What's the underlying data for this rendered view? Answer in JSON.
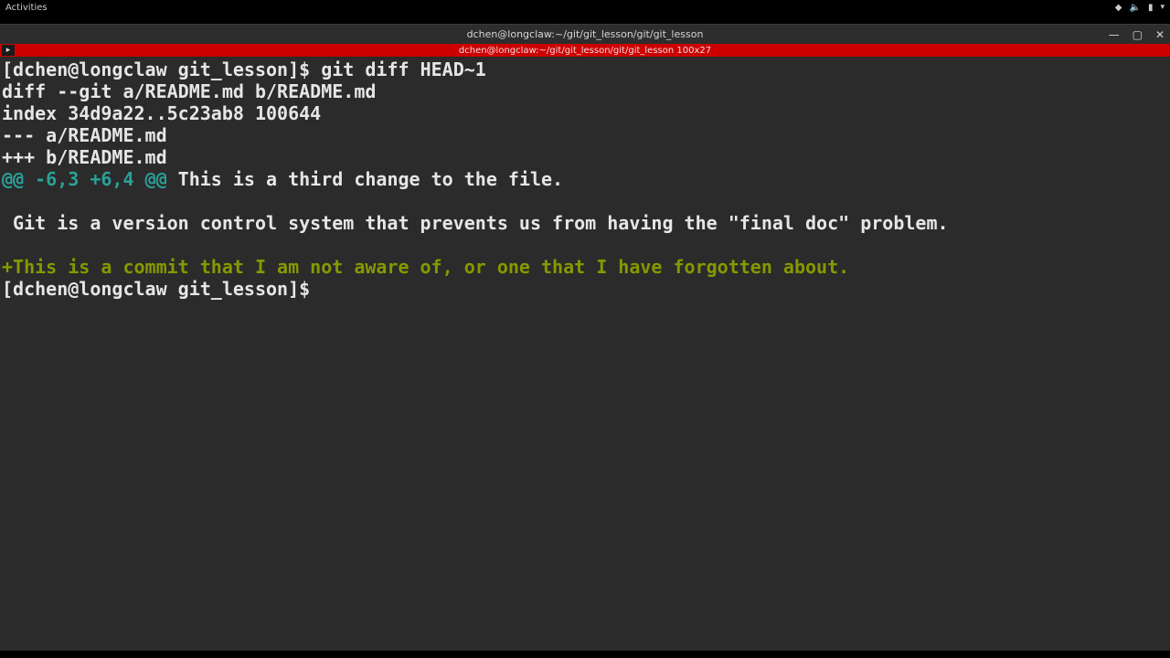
{
  "gnome": {
    "activities": "Activities",
    "network_icon": "◆",
    "volume_icon": "🔈",
    "battery_icon": "▮",
    "menu_icon": "▾"
  },
  "window": {
    "title": "dchen@longclaw:~/git/git_lesson/git/git_lesson",
    "tab_title": "dchen@longclaw:~/git/git_lesson/git/git_lesson 100x27",
    "min": "—",
    "max": "▢",
    "close": "✕",
    "newtab": "▸"
  },
  "term": {
    "prompt1": "[dchen@longclaw git_lesson]$ ",
    "cmd1": "git diff HEAD~1",
    "l2": "diff --git a/README.md b/README.md",
    "l3": "index 34d9a22..5c23ab8 100644",
    "l4": "--- a/README.md",
    "l5": "+++ b/README.md",
    "hunk_a": "@@ -6,3 +6,4 @@",
    "hunk_b": " This is a third change to the file.",
    "blank1": " ",
    "ctx1": " Git is a version control system that prevents us from having the \"final doc\" problem.",
    "blank2": " ",
    "add1": "+This is a commit that I am not aware of, or one that I have forgotten about.",
    "prompt2": "[dchen@longclaw git_lesson]$ "
  }
}
